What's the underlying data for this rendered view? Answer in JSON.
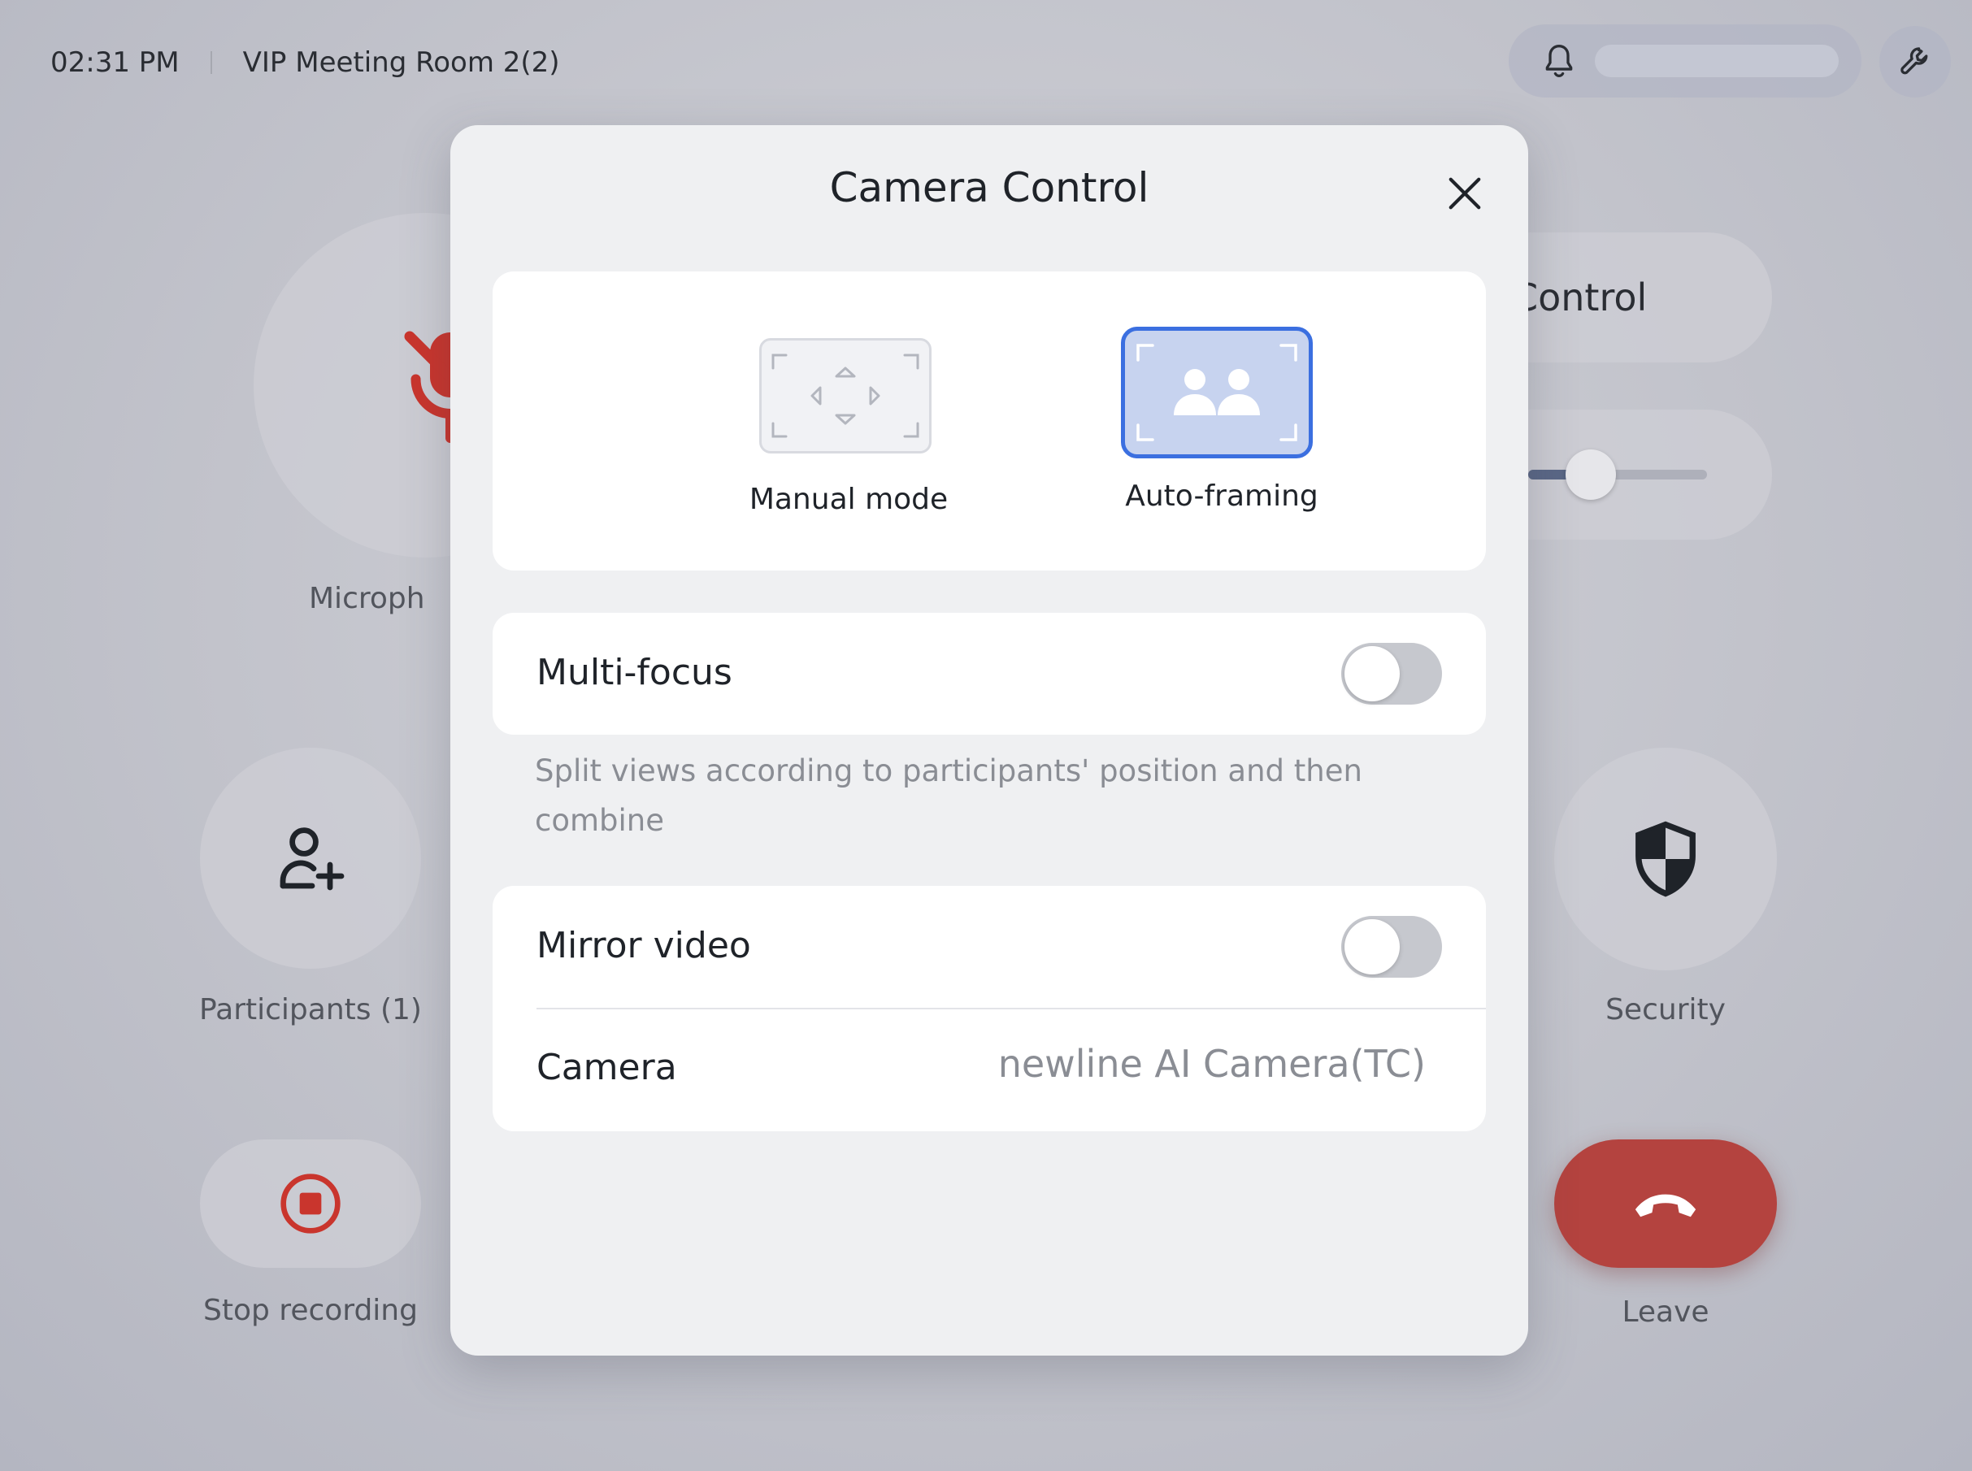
{
  "topbar": {
    "time": "02:31 PM",
    "room_name": "VIP Meeting Room 2(2)"
  },
  "background": {
    "microphone_label": "Microph",
    "participants_label": "Participants (1)",
    "stop_recording_label": "Stop recording",
    "camera_control_label": "Control",
    "security_label": "Security",
    "leave_label": "Leave",
    "volume_level": 0.35
  },
  "dialog": {
    "title": "Camera Control",
    "modes": [
      {
        "label": "Manual mode",
        "selected": false
      },
      {
        "label": "Auto-framing",
        "selected": true
      }
    ],
    "multi_focus": {
      "label": "Multi-focus",
      "enabled": false,
      "description": "Split views according to participants' position and then combine"
    },
    "mirror_video": {
      "label": "Mirror video",
      "enabled": false
    },
    "camera": {
      "label": "Camera",
      "value": "newline AI Camera(TC)"
    }
  },
  "colors": {
    "accent_blue": "#3b6fe0",
    "leave_red": "#b4433f",
    "mic_muted_red": "#c9352d"
  },
  "icons": [
    "bell-icon",
    "wrench-icon",
    "microphone-muted-icon",
    "add-user-icon",
    "stop-record-icon",
    "shield-icon",
    "hang-up-icon",
    "close-icon",
    "manual-mode-icon",
    "auto-framing-icon"
  ]
}
